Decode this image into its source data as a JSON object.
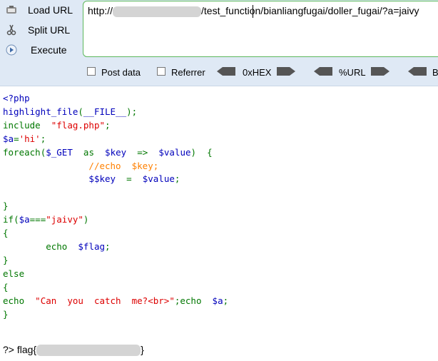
{
  "toolbar": {
    "load_url": "Load URL",
    "split_url": "Split URL",
    "execute": "Execute",
    "url_prefix": "http://",
    "url_suffix": "/test_function/bianliangfugai/doller_fugai/?a=jaivy",
    "post_data": "Post data",
    "referrer": "Referrer",
    "hex": "0xHEX",
    "url_enc": "%URL",
    "base64_partial": "B"
  },
  "code": {
    "l1": "<?php",
    "l2_fn": "highlight_file",
    "l2_arg": "__FILE__",
    "l3_kw": "include",
    "l3_str": "\"flag.php\"",
    "l4_var": "$a",
    "l4_str": "'hi'",
    "l5_kw": "foreach",
    "l5_get": "$_GET",
    "l5_as": "as",
    "l5_key": "$key",
    "l5_val": "$value",
    "l6_comment": "//echo  $key;",
    "l7_varvar": "$$key",
    "l7_val": "$value",
    "l9_if": "if",
    "l9_var": "$a",
    "l9_str": "\"jaivy\"",
    "l11_echo": "echo",
    "l11_flag": "$flag",
    "l13_else": "else",
    "l15_echo": "echo",
    "l15_str": "\"Can  you  catch  me?<br>\"",
    "l15_var": "$a"
  },
  "output": {
    "prefix": "?>",
    "flag_start": "flag{",
    "flag_end": "}"
  },
  "colors": {
    "toolbar_bg": "#dfe9f5",
    "url_border": "#5cb85c",
    "php_blue": "#0000bb",
    "php_green": "#007700",
    "php_red": "#dd0000",
    "php_orange": "#ff8000"
  }
}
